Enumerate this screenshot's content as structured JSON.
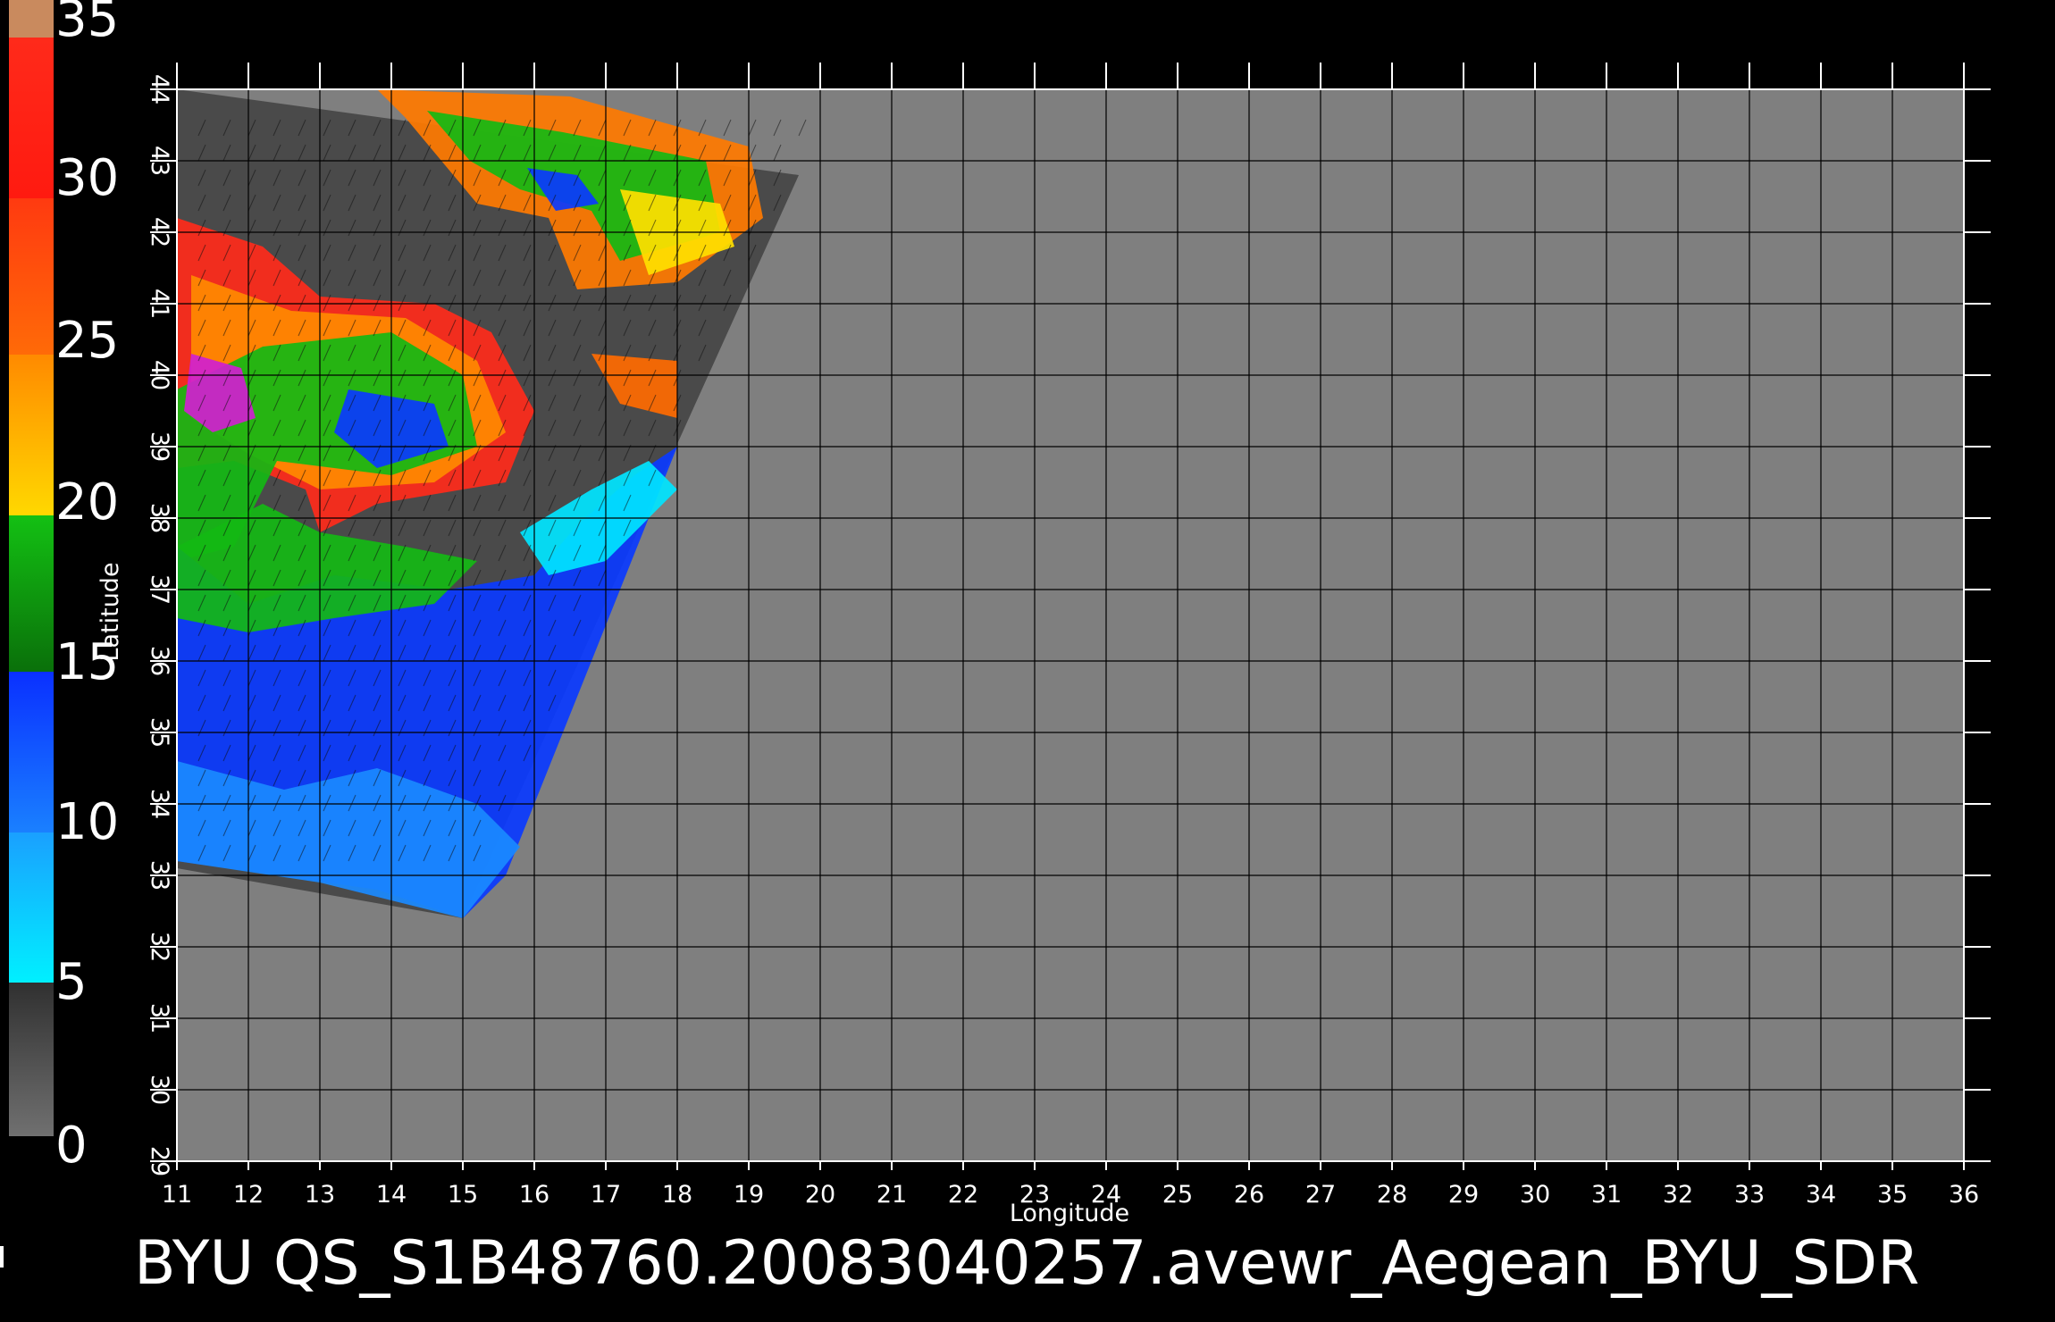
{
  "title": "BYU  QS_S1B48760.20083040257.avewr_Aegean_BYU_SDR",
  "axes": {
    "xlabel": "Longitude",
    "ylabel": "Latitude",
    "lon_range": [
      11,
      36
    ],
    "lat_range": [
      29,
      44
    ],
    "lon_ticks": [
      "11",
      "12",
      "13",
      "14",
      "15",
      "16",
      "17",
      "18",
      "19",
      "20",
      "21",
      "22",
      "23",
      "24",
      "25",
      "26",
      "27",
      "28",
      "29",
      "30",
      "31",
      "32",
      "33",
      "34",
      "35",
      "36"
    ],
    "lat_ticks": [
      "29",
      "30",
      "31",
      "32",
      "33",
      "34",
      "35",
      "36",
      "37",
      "38",
      "39",
      "40",
      "41",
      "42",
      "43",
      "44"
    ],
    "grid": true
  },
  "colorbar": {
    "ticks": [
      "35",
      "30",
      "25",
      "20",
      "15",
      "10",
      "5",
      "0"
    ],
    "range": [
      0,
      35
    ],
    "colors": {
      "top": "#c98a5e",
      "red": "#ff1a1a",
      "red_orange": "#ff4a10",
      "orange": "#ff7a00",
      "yellow_orange": "#ffb000",
      "yellow": "#ffee00",
      "green": "#13b813",
      "dark_green": "#0a7a0a",
      "blue": "#0a3aff",
      "light_blue": "#1a8aff",
      "cyan": "#00eeff",
      "dark_gray": "#3a3a3a",
      "gray": "#6a6a6a"
    }
  },
  "map": {
    "no_data_color": "#7f7f7f",
    "land_mask_color": "#4a4a4a",
    "swath_outline_lonlat": [
      [
        11,
        44
      ],
      [
        19.7,
        42.8
      ],
      [
        15.0,
        32.4
      ],
      [
        11,
        33.1
      ]
    ]
  }
}
